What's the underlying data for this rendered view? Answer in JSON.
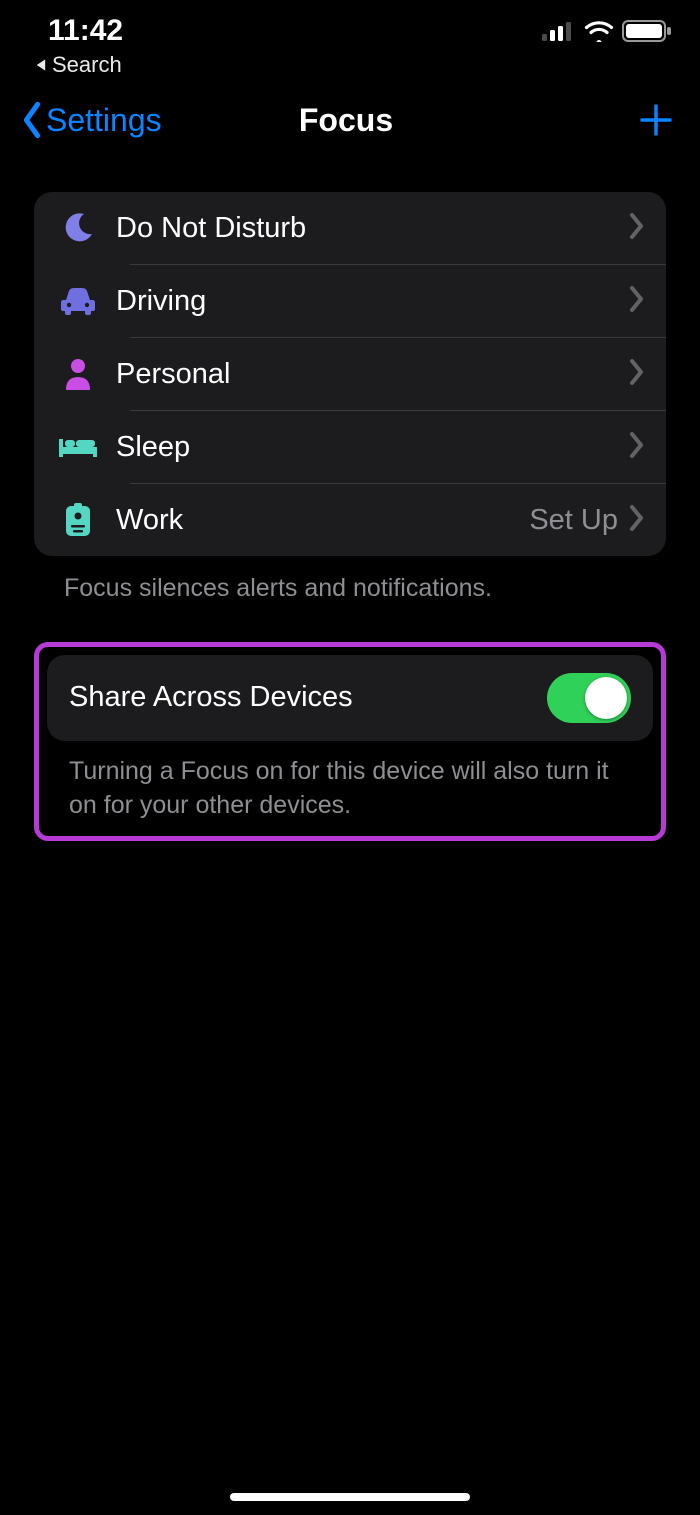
{
  "status": {
    "time": "11:42"
  },
  "breadcrumb": {
    "label": "Search"
  },
  "nav": {
    "back": "Settings",
    "title": "Focus"
  },
  "focus_modes": [
    {
      "icon": "moon",
      "label": "Do Not Disturb",
      "detail": "",
      "color": "#7f7fe8"
    },
    {
      "icon": "car",
      "label": "Driving",
      "detail": "",
      "color": "#6f6fe0"
    },
    {
      "icon": "person",
      "label": "Personal",
      "detail": "",
      "color": "#c84ee6"
    },
    {
      "icon": "bed",
      "label": "Sleep",
      "detail": "",
      "color": "#55d6c2"
    },
    {
      "icon": "badge",
      "label": "Work",
      "detail": "Set Up",
      "color": "#55d6c2"
    }
  ],
  "focus_footer": "Focus silences alerts and notifications.",
  "share": {
    "label": "Share Across Devices",
    "on": true,
    "footer": "Turning a Focus on for this device will also turn it on for your other devices."
  }
}
